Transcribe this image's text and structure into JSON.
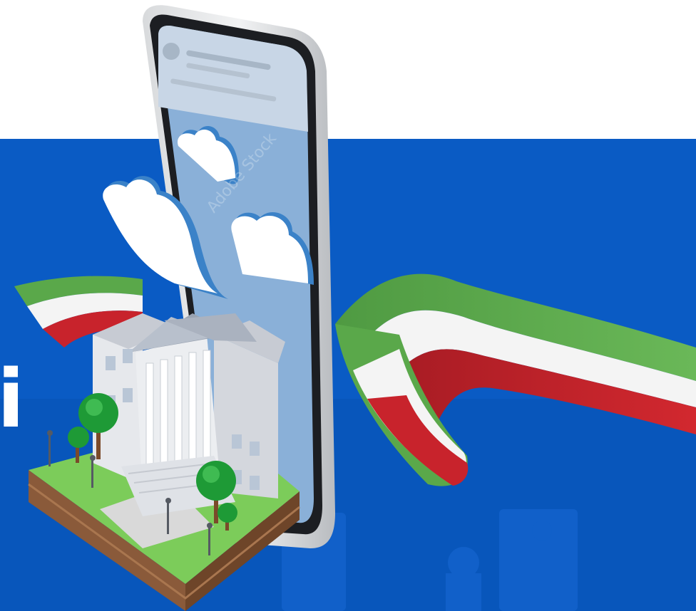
{
  "banner": {
    "cropped_heading": "i",
    "colors": {
      "background_top": "#ffffff",
      "background_blue": "#0a5bc4",
      "flag_green": "#5aa84a",
      "flag_white": "#f4f4f4",
      "flag_red": "#c8232c",
      "phone_screen": "#8ab0d8",
      "grass": "#7ccc5a",
      "soil": "#8a5a3a"
    },
    "watermark": "Adobe Stock"
  }
}
